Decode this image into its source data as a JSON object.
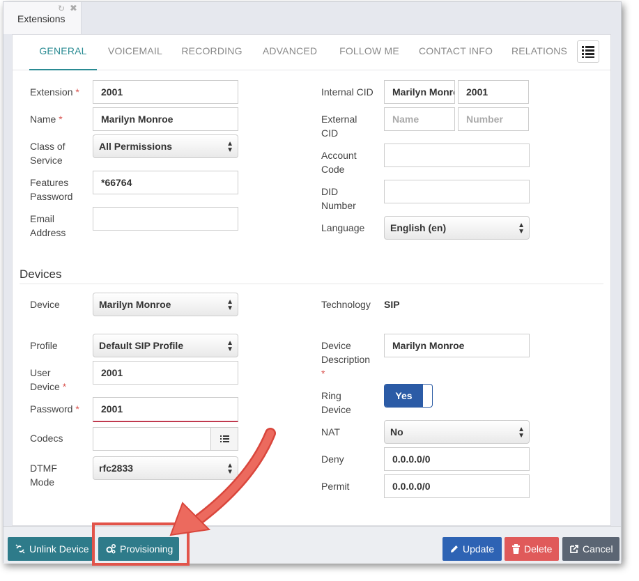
{
  "window": {
    "tab_title": "Extensions"
  },
  "tabs": [
    {
      "label": "GENERAL"
    },
    {
      "label": "VOICEMAIL"
    },
    {
      "label": "RECORDING"
    },
    {
      "label": "ADVANCED"
    },
    {
      "label": "FOLLOW ME"
    },
    {
      "label": "CONTACT INFO"
    },
    {
      "label": "RELATIONS"
    }
  ],
  "general": {
    "extension": {
      "label": "Extension",
      "value": "2001"
    },
    "name": {
      "label": "Name",
      "value": "Marilyn Monroe"
    },
    "class_of_service": {
      "label_1": "Class of",
      "label_2": "Service",
      "value": "All Permissions"
    },
    "features_password": {
      "label_1": "Features",
      "label_2": "Password",
      "value": "*66764"
    },
    "email_address": {
      "label_1": "Email",
      "label_2": "Address",
      "value": ""
    },
    "internal_cid": {
      "label": "Internal CID",
      "name_value": "Marilyn Monroe",
      "number_value": "2001"
    },
    "external_cid": {
      "label_1": "External",
      "label_2": "CID",
      "name_placeholder": "Name",
      "number_placeholder": "Number"
    },
    "account_code": {
      "label_1": "Account",
      "label_2": "Code",
      "value": ""
    },
    "did_number": {
      "label_1": "DID",
      "label_2": "Number",
      "value": ""
    },
    "language": {
      "label": "Language",
      "value": "English (en)"
    }
  },
  "devices": {
    "section_title": "Devices",
    "device": {
      "label": "Device",
      "value": "Marilyn Monroe"
    },
    "technology": {
      "label": "Technology",
      "value": "SIP"
    },
    "profile": {
      "label": "Profile",
      "value": "Default SIP Profile"
    },
    "device_description": {
      "label_1": "Device",
      "label_2": "Description",
      "value": "Marilyn Monroe"
    },
    "user_device": {
      "label_1": "User",
      "label_2": "Device",
      "value": "2001"
    },
    "ring_device": {
      "label_1": "Ring",
      "label_2": "Device",
      "value": "Yes"
    },
    "password": {
      "label": "Password",
      "value": "2001"
    },
    "nat": {
      "label": "NAT",
      "value": "No"
    },
    "codecs": {
      "label": "Codecs",
      "value": ""
    },
    "deny": {
      "label": "Deny",
      "value": "0.0.0.0/0"
    },
    "dtmf_mode": {
      "label_1": "DTMF",
      "label_2": "Mode",
      "value": "rfc2833"
    },
    "permit": {
      "label": "Permit",
      "value": "0.0.0.0/0"
    }
  },
  "required_marker": "*",
  "footer": {
    "unlink_device": "Unlink Device",
    "provisioning": "Provisioning",
    "update": "Update",
    "delete": "Delete",
    "cancel": "Cancel"
  },
  "colors": {
    "accent": "#2a8b93",
    "update_button": "#2e63b4",
    "delete_button": "#e05a5a",
    "cancel_button": "#5b6573",
    "teal_button": "#2e7b8a",
    "highlight": "#e2544a"
  },
  "icons": {
    "refresh": "refresh-icon",
    "close": "close-icon",
    "tab_menu": "list-icon",
    "unlink": "unlink-icon",
    "provisioning": "gears-icon",
    "update": "pencil-icon",
    "delete": "trash-icon",
    "cancel": "share-icon"
  }
}
